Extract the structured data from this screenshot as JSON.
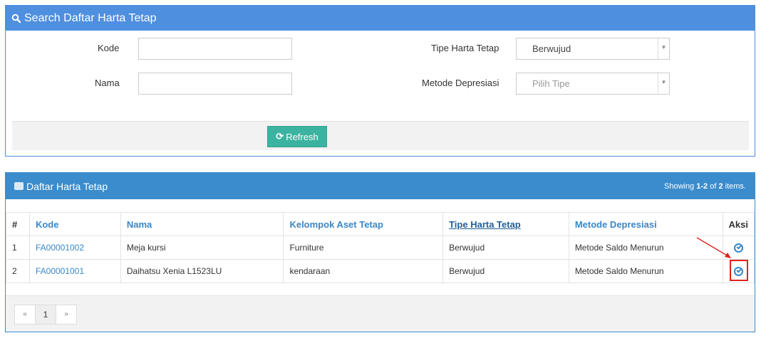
{
  "search": {
    "title": "Search Daftar Harta Tetap",
    "kode_label": "Kode",
    "kode_value": "",
    "nama_label": "Nama",
    "nama_value": "",
    "tipe_label": "Tipe Harta Tetap",
    "tipe_value": "Berwujud",
    "metode_label": "Metode Depresiasi",
    "metode_placeholder": "Pilih Tipe",
    "refresh_label": "Refresh"
  },
  "list": {
    "title": "Daftar Harta Tetap",
    "summary_prefix": "Showing ",
    "summary_range": "1-2",
    "summary_mid": " of ",
    "summary_total": "2",
    "summary_suffix": " items.",
    "columns": [
      "#",
      "Kode",
      "Nama",
      "Kelompok Aset Tetap",
      "Tipe Harta Tetap",
      "Metode Depresiasi",
      "Aksi"
    ],
    "rows": [
      {
        "num": "1",
        "kode": "FA00001002",
        "nama": "Meja kursi",
        "kelompok": "Furniture",
        "tipe": "Berwujud",
        "metode": "Metode Saldo Menurun"
      },
      {
        "num": "2",
        "kode": "FA00001001",
        "nama": "Daihatsu Xenia L1523LU",
        "kelompok": "kendaraan",
        "tipe": "Berwujud",
        "metode": "Metode Saldo Menurun"
      }
    ]
  },
  "pager": {
    "prev": "«",
    "page": "1",
    "next": "»"
  },
  "icons": {
    "search": "search-icon",
    "refresh": "refresh-icon",
    "briefcase": "briefcase-icon",
    "view": "check-circle-icon"
  },
  "colors": {
    "search_header": "#4e8fe0",
    "list_header": "#3a8ccd",
    "refresh_button": "#3cb3a0",
    "annotation": "#e0221c"
  }
}
